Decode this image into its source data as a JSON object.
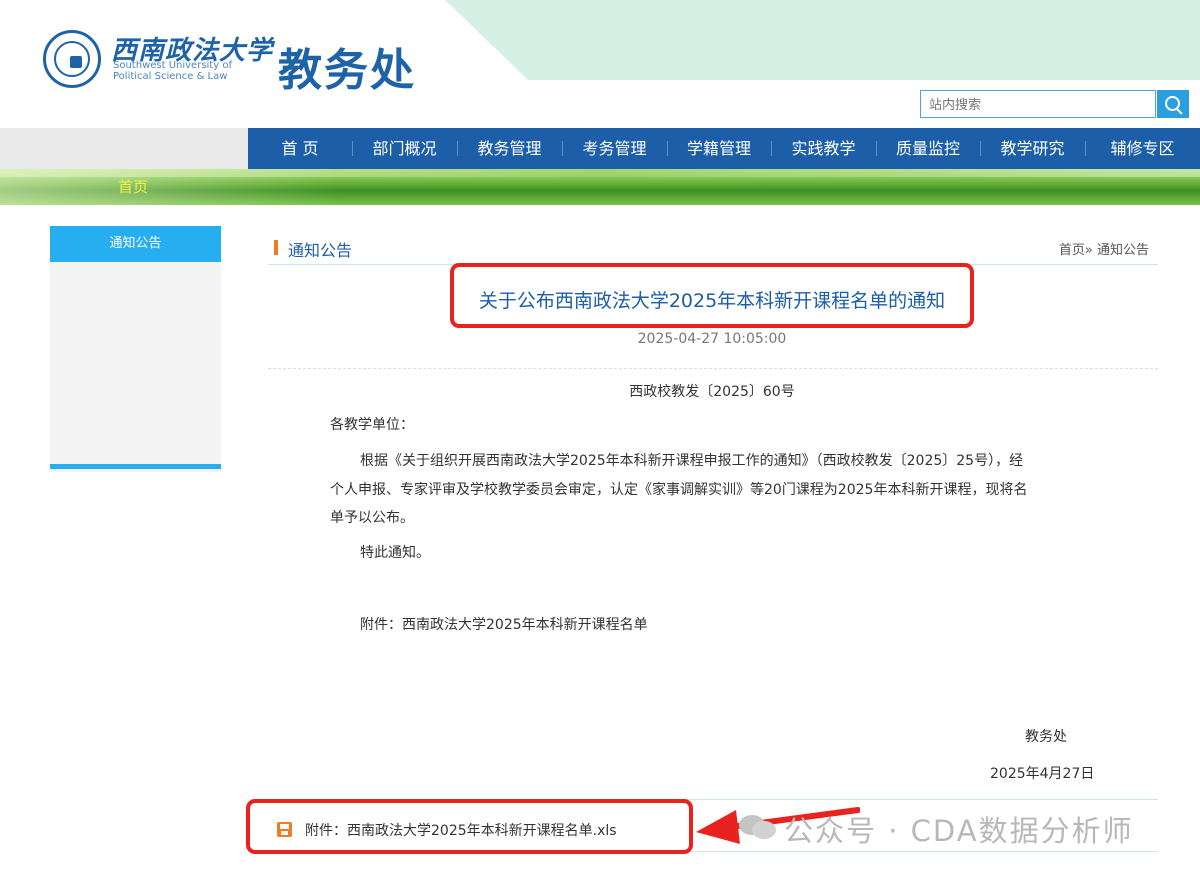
{
  "header": {
    "logo_cn": "西南政法大学",
    "logo_en_line1": "Southwest University of",
    "logo_en_line2": "Political Science & Law",
    "dept_title": "教务处"
  },
  "search": {
    "placeholder": "站内搜索"
  },
  "nav": {
    "items": [
      "首 页",
      "部门概况",
      "教务管理",
      "考务管理",
      "学籍管理",
      "实践教学",
      "质量监控",
      "教学研究",
      "辅修专区"
    ]
  },
  "banner": {
    "label": "首页"
  },
  "sidebar": {
    "items": [
      {
        "label": "通知公告"
      }
    ]
  },
  "section": {
    "title": "通知公告",
    "breadcrumb": "首页» 通知公告"
  },
  "article": {
    "title": "关于公布西南政法大学2025年本科新开课程名单的通知",
    "time": "2025-04-27 10:05:00",
    "doc_no": "西政校教发〔2025〕60号",
    "salutation": "各教学单位：",
    "body_line1": "根据《关于组织开展西南政法大学2025年本科新开课程申报工作的通知》（西政校教发〔2025〕25号），经",
    "body_line2": "个人申报、专家评审及学校教学委员会审定，认定《家事调解实训》等20门课程为2025年本科新开课程，现将名",
    "body_line3": "单予以公布。",
    "notice": "特此通知。",
    "attachment_note": "附件：西南政法大学2025年本科新开课程名单",
    "sign_dept": "教务处",
    "sign_date": "2025年4月27日"
  },
  "attachment": {
    "label": "附件：西南政法大学2025年本科新开课程名单.xls",
    "icon": "file-icon"
  },
  "watermark": {
    "text": "公众号 · CDA数据分析师"
  },
  "colors": {
    "nav_blue": "#1c5ea8",
    "accent_cyan": "#27aef0",
    "highlight_red": "#e8231f",
    "section_orange": "#f07b22"
  }
}
